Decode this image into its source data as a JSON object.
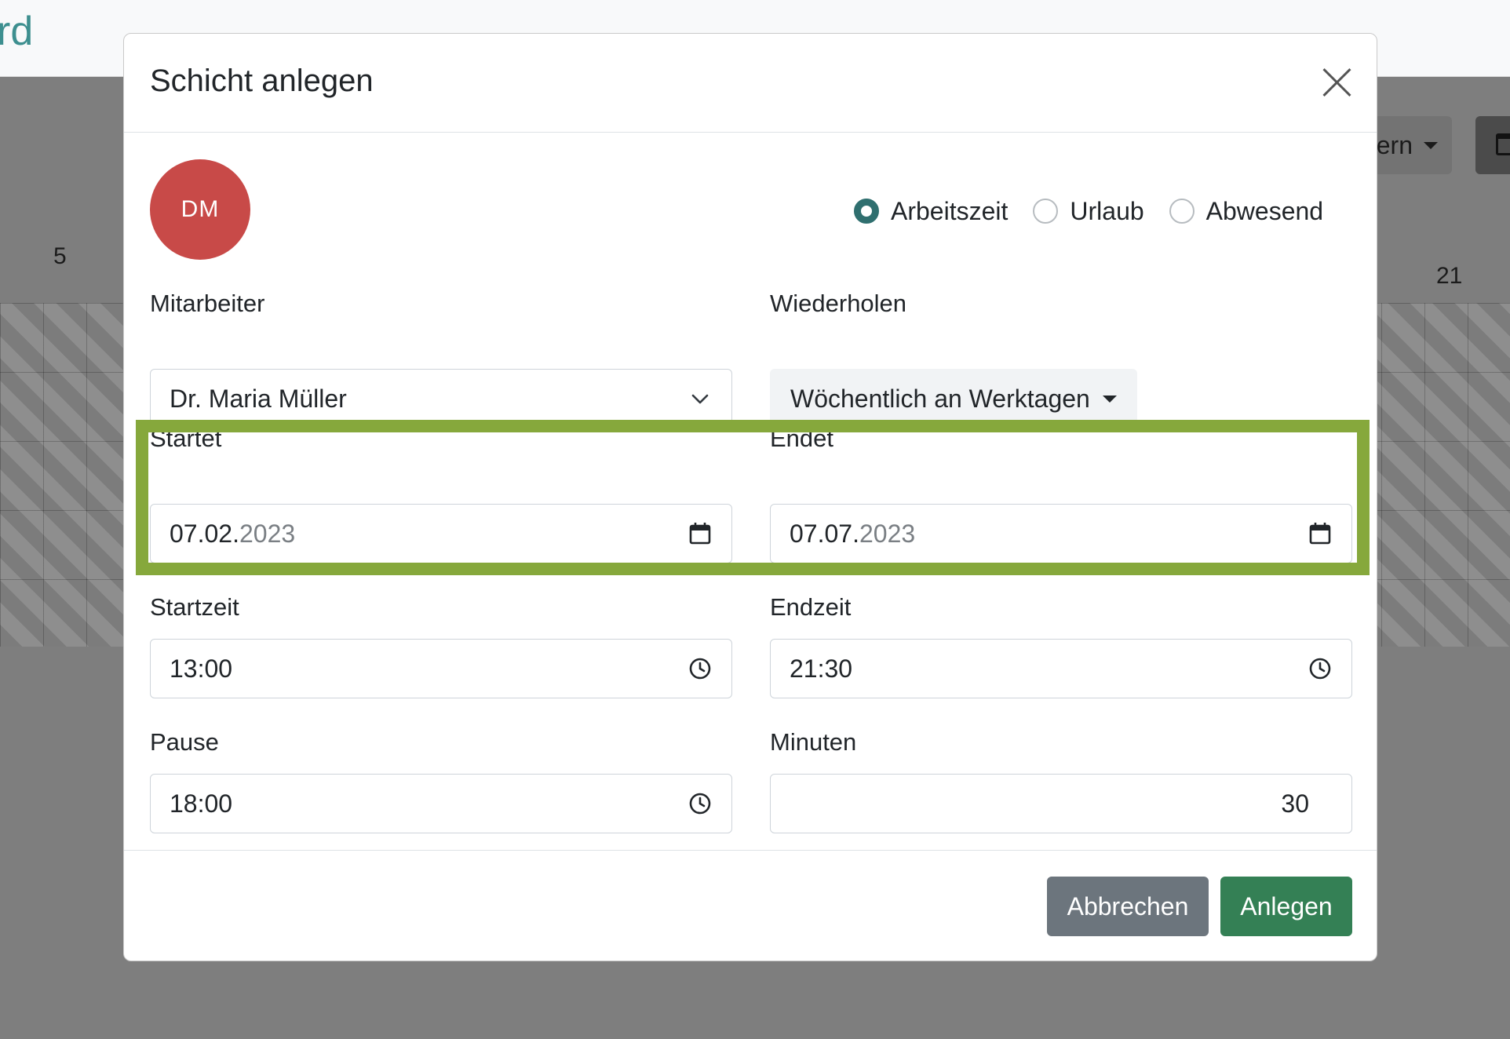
{
  "background": {
    "brand_partial": "rd",
    "filter_partial": "tern",
    "day_left": "5",
    "day_right": "21"
  },
  "modal": {
    "title": "Schicht anlegen",
    "avatar_initials": "DM",
    "avatar_color": "#c84a48",
    "shift_types": [
      {
        "label": "Arbeitszeit",
        "checked": true
      },
      {
        "label": "Urlaub",
        "checked": false
      },
      {
        "label": "Abwesend",
        "checked": false
      }
    ],
    "employee": {
      "label": "Mitarbeiter",
      "value": "Dr. Maria Müller"
    },
    "repeat": {
      "label": "Wiederholen",
      "value": "Wöchentlich an Werktagen"
    },
    "start_date": {
      "label": "Startet",
      "value_day_month": "07.02.",
      "value_year": "2023"
    },
    "end_date": {
      "label": "Endet",
      "value_day_month": "07.07.",
      "value_year": "2023"
    },
    "start_time": {
      "label": "Startzeit",
      "value": "13:00"
    },
    "end_time": {
      "label": "Endzeit",
      "value": "21:30"
    },
    "break_time": {
      "label": "Pause",
      "value": "18:00"
    },
    "break_minutes": {
      "label": "Minuten",
      "value": "30"
    },
    "buttons": {
      "cancel": "Abbrechen",
      "create": "Anlegen"
    }
  },
  "colors": {
    "primary_teal": "#2f6f6f",
    "create_green": "#348055",
    "cancel_gray": "#6c757d",
    "highlight": "#86a83c"
  }
}
